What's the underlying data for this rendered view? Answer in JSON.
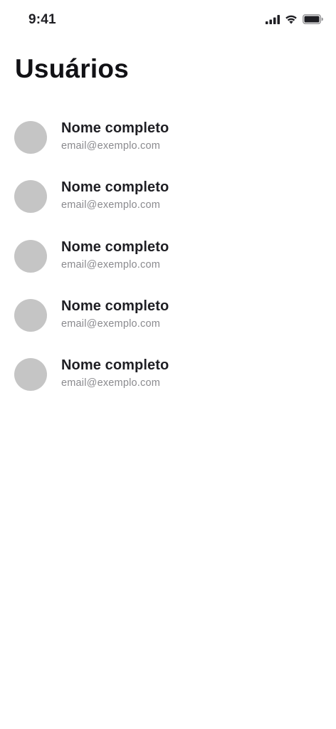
{
  "status_bar": {
    "time": "9:41",
    "icons": [
      "cellular-signal-icon",
      "wifi-icon",
      "battery-icon"
    ]
  },
  "page": {
    "title": "Usuários"
  },
  "users": [
    {
      "name": "Nome completo",
      "email": "email@exemplo.com"
    },
    {
      "name": "Nome completo",
      "email": "email@exemplo.com"
    },
    {
      "name": "Nome completo",
      "email": "email@exemplo.com"
    },
    {
      "name": "Nome completo",
      "email": "email@exemplo.com"
    },
    {
      "name": "Nome completo",
      "email": "email@exemplo.com"
    }
  ],
  "colors": {
    "avatar_placeholder": "#c5c5c5",
    "name_text": "#1f1f24",
    "email_text": "#8a8a8e",
    "background": "#ffffff"
  }
}
